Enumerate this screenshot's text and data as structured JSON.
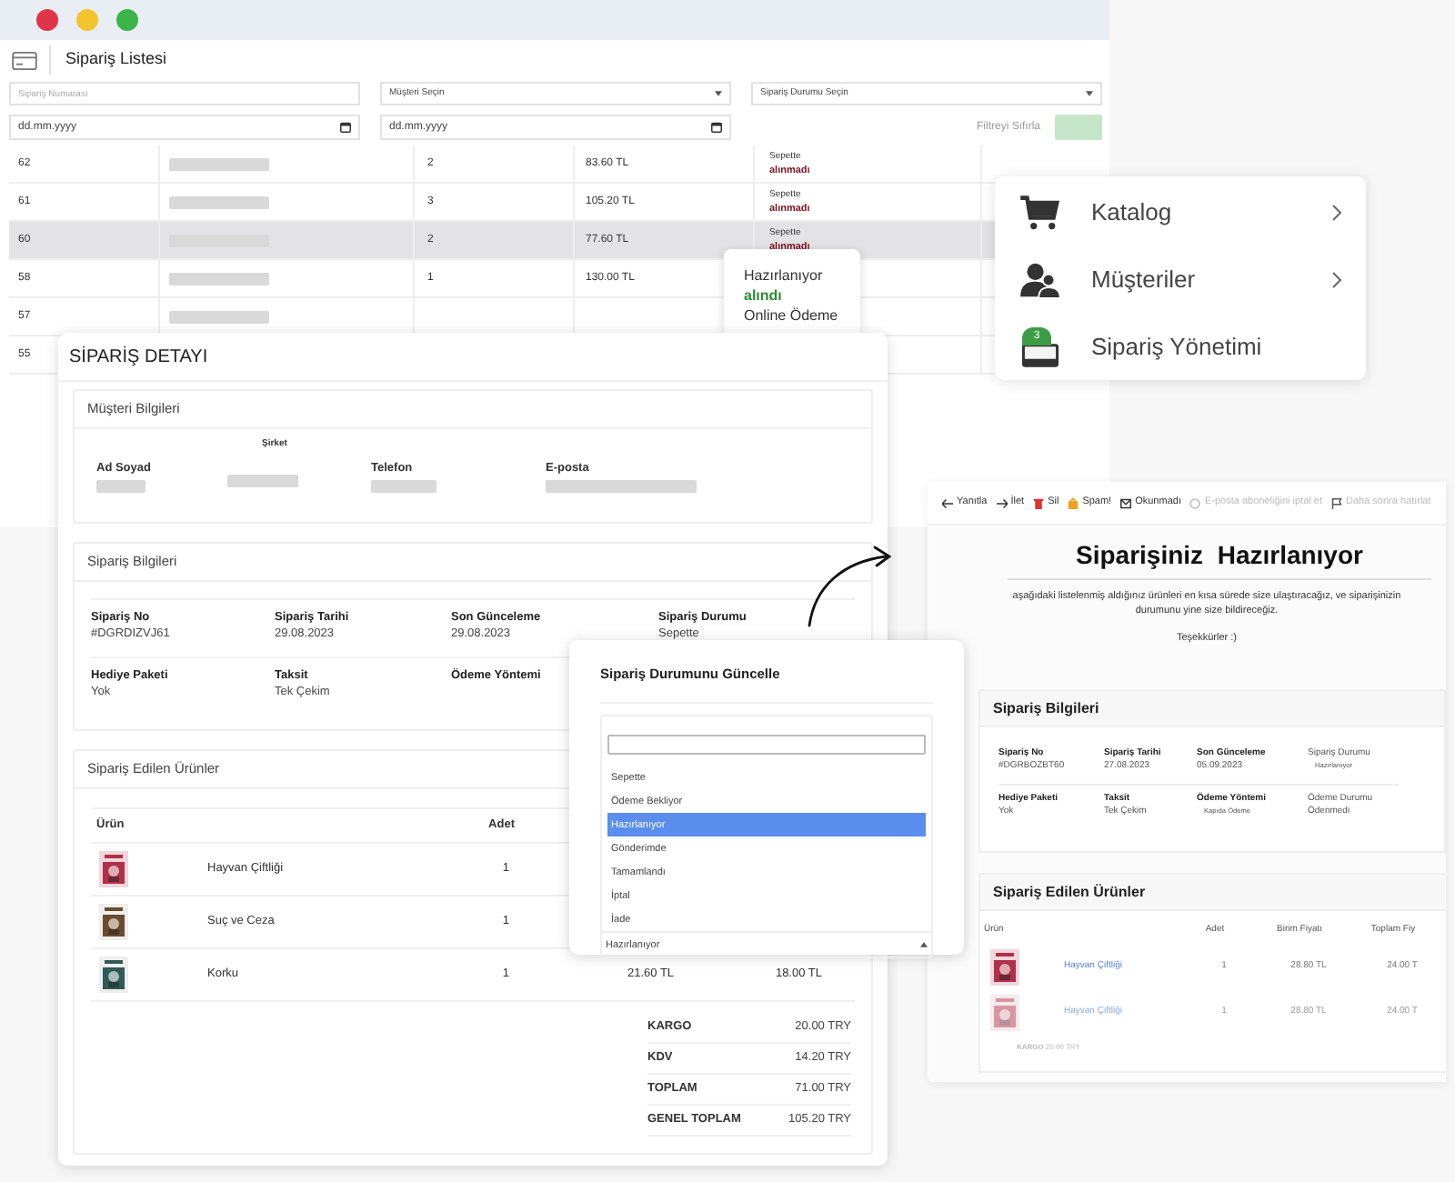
{
  "list_window": {
    "title": "Sipariş Listesi",
    "filters": [
      {
        "kind": "input",
        "placeholder": "Sipariş Numarası"
      },
      {
        "kind": "select",
        "value": "Müşteri Seçin"
      },
      {
        "kind": "select",
        "value": "Sipariş Durumu Seçin"
      },
      {
        "kind": "date",
        "value": "dd.mm.yyyy"
      },
      {
        "kind": "date",
        "value": "dd.mm.yyyy"
      }
    ],
    "reset_filter": "Filtreyi Sıfırla",
    "rows": [
      {
        "id": "62",
        "qty": "2",
        "price": "83.60 TL",
        "status": "Sepette",
        "payment": "alınmadı",
        "paid": false,
        "selected": false
      },
      {
        "id": "61",
        "qty": "3",
        "price": "105.20 TL",
        "status": "Sepette",
        "payment": "alınmadı",
        "paid": false,
        "selected": false
      },
      {
        "id": "60",
        "qty": "2",
        "price": "77.60 TL",
        "status": "Sepette",
        "payment": "alınmadı",
        "paid": false,
        "selected": true
      },
      {
        "id": "58",
        "qty": "1",
        "price": "130.00 TL",
        "selected": false
      },
      {
        "id": "57",
        "selected": false
      },
      {
        "id": "55",
        "selected": false
      }
    ]
  },
  "status_popover": {
    "status": "Hazırlanıyor",
    "payment": "alındı",
    "paid": true,
    "method": "Online Ödeme"
  },
  "menu": {
    "items": [
      {
        "label": "Katalog",
        "has_submenu": true
      },
      {
        "label": "Müşteriler",
        "has_submenu": true
      },
      {
        "label": "Sipariş Yönetimi",
        "badge": "3",
        "has_submenu": false
      }
    ]
  },
  "order_detail": {
    "title": "SİPARİŞ DETAYI",
    "customer": {
      "title": "Müşteri Bilgileri",
      "fields": [
        "Ad Soyad",
        "Şirket",
        "Telefon",
        "E-posta"
      ]
    },
    "order_info": {
      "title": "Sipariş Bilgileri",
      "fields": [
        {
          "label": "Sipariş No",
          "value": "#DGRDIZVJ61"
        },
        {
          "label": "Sipariş Tarihi",
          "value": "29.08.2023"
        },
        {
          "label": "Son Günceleme",
          "value": "29.08.2023"
        },
        {
          "label": "Sipariş Durumu",
          "value": "Sepette"
        },
        {
          "label": "Hediye Paketi",
          "value": "Yok"
        },
        {
          "label": "Taksit",
          "value": "Tek Çekim"
        },
        {
          "label": "Ödeme Yöntemi"
        }
      ]
    },
    "products": {
      "title": "Sipariş Edilen Ürünler",
      "columns": [
        "Ürün",
        "Adet"
      ],
      "rows": [
        {
          "name": "Hayvan Çiftliği",
          "qty": "1"
        },
        {
          "name": "Suç ve Ceza",
          "qty": "1"
        },
        {
          "name": "Korku",
          "qty": "1",
          "unit_price": "21.60 TL",
          "total": "18.00 TL"
        }
      ],
      "totals": [
        {
          "label": "KARGO",
          "value": "20.00 TRY"
        },
        {
          "label": "KDV",
          "value": "14.20 TRY"
        },
        {
          "label": "TOPLAM",
          "value": "71.00 TRY"
        },
        {
          "label": "GENEL TOPLAM",
          "value": "105.20 TRY"
        }
      ]
    }
  },
  "status_modal": {
    "title": "Sipariş Durumunu Güncelle",
    "options": [
      {
        "label": "Sepette",
        "selected": false
      },
      {
        "label": "Ödeme Bekliyor",
        "selected": false
      },
      {
        "label": "Hazırlanıyor",
        "selected": true
      },
      {
        "label": "Gönderimde",
        "selected": false
      },
      {
        "label": "Tamamlandı",
        "selected": false
      },
      {
        "label": "İptal",
        "selected": false
      },
      {
        "label": "İade",
        "selected": false
      }
    ],
    "value": "Hazırlanıyor"
  },
  "email": {
    "toolbar": [
      {
        "label": "Yanıtla",
        "disabled": false
      },
      {
        "label": "İlet",
        "disabled": false
      },
      {
        "label": "Sil",
        "disabled": false
      },
      {
        "label": "Spam!",
        "disabled": false
      },
      {
        "label": "Okunmadı",
        "disabled": false
      },
      {
        "label": "E-posta aboneliğini iptal et",
        "disabled": true
      },
      {
        "label": "Daha sonra hatırlat",
        "disabled": true
      }
    ],
    "heading": "Siparişiniz  Hazırlanıyor",
    "message": "aşağıdaki listelenmiş aldığınız ürünleri en kısa sürede size ulaştıracağız, ve siparişinizin durumunu yine size bildireceğiz.",
    "thanks": "Teşekkürler :)",
    "order_info": {
      "title": "Sipariş Bilgileri",
      "fields": [
        {
          "label": "Sipariş No",
          "value": "#DGRBOZBT60"
        },
        {
          "label": "Sipariş Tarihi",
          "value": "27.08.2023"
        },
        {
          "label": "Son Günceleme",
          "value": "05.09.2023"
        },
        {
          "label": "Sipariş Durumu",
          "value": "Hazırlanıyor"
        },
        {
          "label": "Hediye Paketi",
          "value": "Yok"
        },
        {
          "label": "Taksit",
          "value": "Tek Çekim"
        },
        {
          "label": "Ödeme Yöntemi",
          "value": "Kapıda Ödeme"
        },
        {
          "label": "Ödeme Durumu",
          "value": "Ödenmedi"
        }
      ]
    },
    "products": {
      "title": "Sipariş Edilen Ürünler",
      "columns": [
        "Ürün",
        "Adet",
        "Birim Fiyatı",
        "Toplam Fiy"
      ],
      "rows": [
        {
          "name": "Hayvan Çiftliği",
          "qty": "1",
          "unit_price": "28.80 TL",
          "total": "24.00 T",
          "dimmed": false
        },
        {
          "name": "Hayvan Çiftliği",
          "qty": "1",
          "unit_price": "28.80 TL",
          "total": "24.00 T",
          "dimmed": true
        }
      ],
      "totals": [
        {
          "label": "KARGO",
          "value": "20.00 TRY"
        }
      ]
    }
  }
}
